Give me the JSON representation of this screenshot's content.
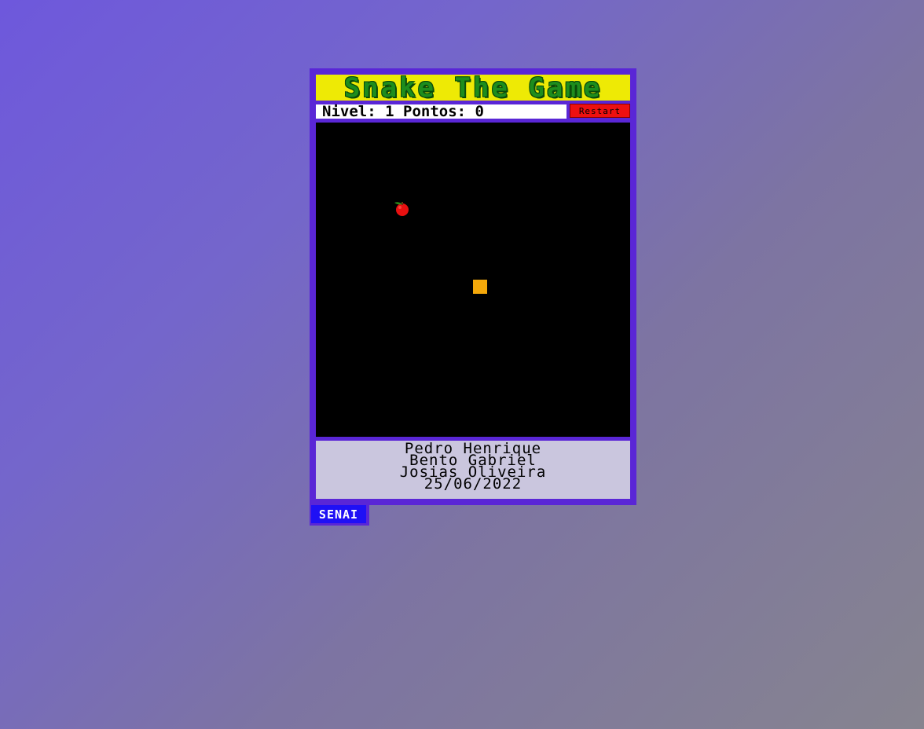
{
  "game": {
    "title": "Snake The Game",
    "level_label": "Nivel:",
    "level_value": "1",
    "points_label": "Pontos:",
    "points_value": "0",
    "restart_label": "Restart"
  },
  "board": {
    "background": "#000000",
    "apple_icon": "apple-icon",
    "snake_color": "#f4a80a"
  },
  "credits": {
    "lines": [
      "Pedro Henrique",
      "Bento Gabriel",
      "Josias Oliveira",
      "25/06/2022"
    ]
  },
  "brand": {
    "label": "SENAI"
  },
  "colors": {
    "frame": "#5a26d6",
    "title_bg": "#eeea05",
    "title_text": "#1d8d1d",
    "restart_bg": "#ee1010",
    "credits_bg": "#cac6de",
    "brand_bg": "#1f10f5"
  }
}
